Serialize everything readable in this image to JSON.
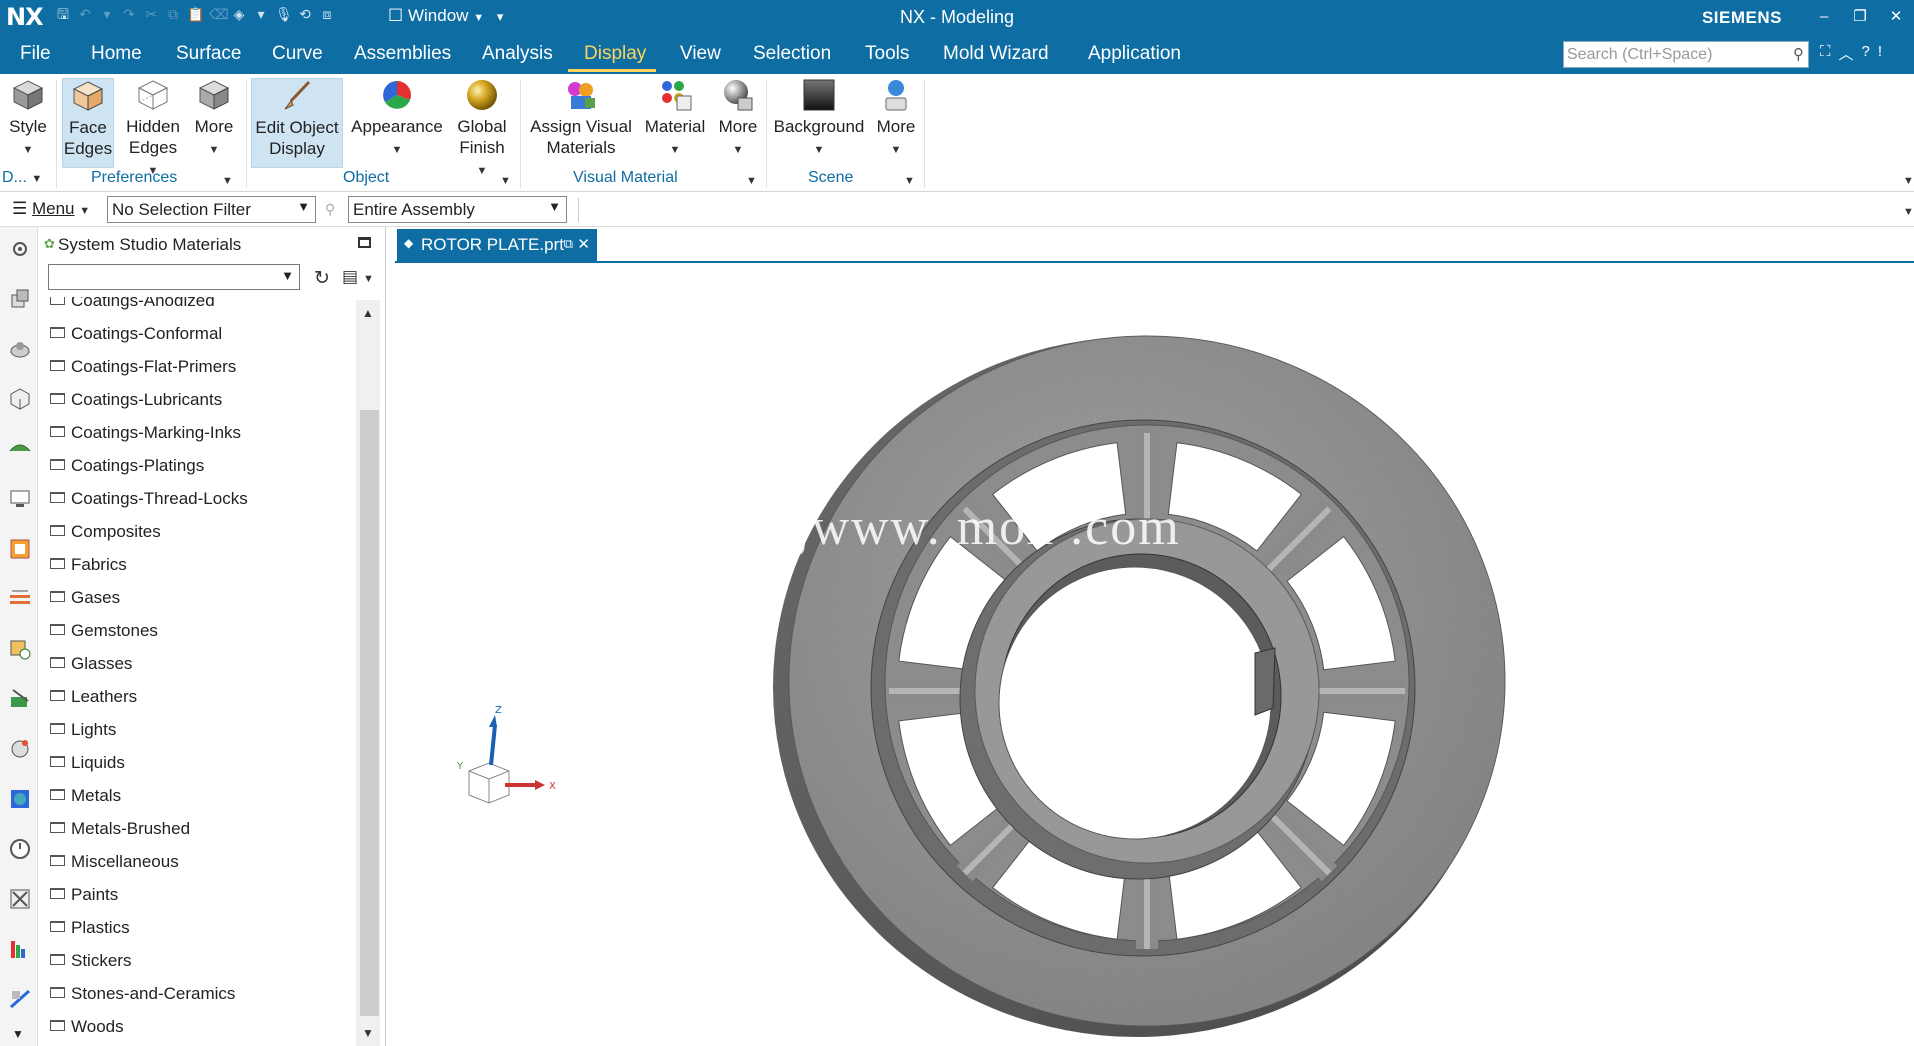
{
  "titlebar": {
    "logo": "NX",
    "window_menu": "Window",
    "title": "NX - Modeling",
    "brand": "SIEMENS"
  },
  "menubar": {
    "items": [
      "File",
      "Home",
      "Surface",
      "Curve",
      "Assemblies",
      "Analysis",
      "Display",
      "View",
      "Selection",
      "Tools",
      "Mold Wizard",
      "Application"
    ],
    "active": "Display",
    "search_placeholder": "Search (Ctrl+Space)"
  },
  "ribbon": {
    "buttons": {
      "style": "Style",
      "face_edges_1": "Face",
      "face_edges_2": "Edges",
      "hidden_edges_1": "Hidden",
      "hidden_edges_2": "Edges",
      "more_1": "More",
      "edit_object_display_1": "Edit Object",
      "edit_object_display_2": "Display",
      "appearance": "Appearance",
      "global_finish_1": "Global",
      "global_finish_2": "Finish",
      "assign_visual_materials_1": "Assign Visual",
      "assign_visual_materials_2": "Materials",
      "material": "Material",
      "more_2": "More",
      "background": "Background",
      "more_3": "More"
    },
    "groups": {
      "display": "D...",
      "preferences": "Preferences",
      "object": "Object",
      "visual_material": "Visual Material",
      "scene": "Scene"
    }
  },
  "selectionbar": {
    "menu": "Menu",
    "filter": "No Selection Filter",
    "scope": "Entire Assembly"
  },
  "navigator": {
    "title": "System Studio Materials",
    "items": [
      "Coatings-Anodized",
      "Coatings-Conformal",
      "Coatings-Flat-Primers",
      "Coatings-Lubricants",
      "Coatings-Marking-Inks",
      "Coatings-Platings",
      "Coatings-Thread-Locks",
      "Composites",
      "Fabrics",
      "Gases",
      "Gemstones",
      "Glasses",
      "Leathers",
      "Lights",
      "Liquids",
      "Metals",
      "Metals-Brushed",
      "Miscellaneous",
      "Paints",
      "Plastics",
      "Stickers",
      "Stones-and-Ceramics",
      "Woods"
    ]
  },
  "graphics": {
    "tab_label": "ROTOR PLATE.prt",
    "watermark": "jwww.      mox .com",
    "triad": {
      "z": "Z",
      "y": "Y",
      "x": "X"
    }
  },
  "colors": {
    "brand_blue": "#0e6da3",
    "active_menu": "#ffd35a",
    "group_label": "#0e6da3"
  }
}
